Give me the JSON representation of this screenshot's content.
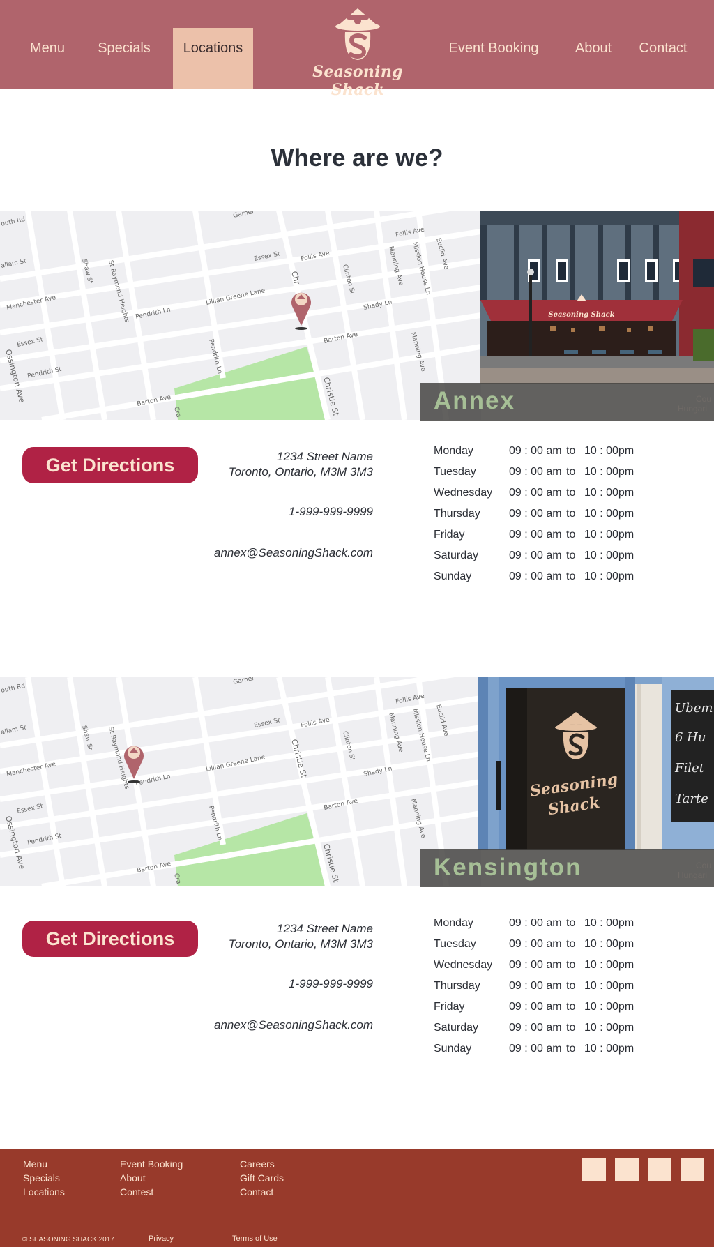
{
  "header": {
    "nav": [
      {
        "label": "Menu"
      },
      {
        "label": "Specials"
      },
      {
        "label": "Locations"
      },
      {
        "label": "Event Booking"
      },
      {
        "label": "About"
      },
      {
        "label": "Contact"
      }
    ],
    "logo_text": "Seasoning Shack"
  },
  "page_title": "Where are we?",
  "map_labels": {
    "streets": [
      "outh Rd",
      "allam St",
      "Manchester Ave",
      "Essex St",
      "Pendrith St",
      "Ossington Ave",
      "Shaw St",
      "St Raymond Heights",
      "Pendrith Ln",
      "Lillian Greene Lane",
      "Essex St",
      "Follis Ave",
      "Follis Ave",
      "Clinton St",
      "Manning Ave",
      "Mission House Ln",
      "Euclid Ave",
      "Shady Ln",
      "Barton Ave",
      "Barton Ave",
      "Pendrith Ln",
      "Christie St",
      "Manning Ave",
      "Garner",
      "Cra"
    ],
    "annex_pin_street": "Chr",
    "overlay_right": [
      "Cou",
      "Hungari"
    ]
  },
  "annex_sign_text": "Seasoning Shack",
  "kensington_sign_text": [
    "Seasoning",
    "Shack"
  ],
  "chalkboard_text": [
    "Ubem",
    "6 Hu",
    "Filet",
    "Tarte"
  ],
  "locations": [
    {
      "name": "Annex",
      "directions_label": "Get Directions",
      "address_line1": "1234 Street Name",
      "address_line2": "Toronto, Ontario, M3M 3M3",
      "phone": "1-999-999-9999",
      "email": "annex@SeasoningShack.com",
      "hours": [
        {
          "day": "Monday",
          "open": "09 : 00 am",
          "to": "to",
          "close": "10 : 00pm"
        },
        {
          "day": "Tuesday",
          "open": "09 : 00 am",
          "to": "to",
          "close": "10 : 00pm"
        },
        {
          "day": "Wednesday",
          "open": "09 : 00 am",
          "to": "to",
          "close": "10 : 00pm"
        },
        {
          "day": "Thursday",
          "open": "09 : 00 am",
          "to": "to",
          "close": "10 : 00pm"
        },
        {
          "day": "Friday",
          "open": "09 : 00 am",
          "to": "to",
          "close": "10 : 00pm"
        },
        {
          "day": "Saturday",
          "open": "09 : 00 am",
          "to": "to",
          "close": "10 : 00pm"
        },
        {
          "day": "Sunday",
          "open": "09 : 00 am",
          "to": "to",
          "close": "10 : 00pm"
        }
      ]
    },
    {
      "name": "Kensington",
      "directions_label": "Get Directions",
      "address_line1": "1234 Street Name",
      "address_line2": "Toronto, Ontario, M3M 3M3",
      "phone": "1-999-999-9999",
      "email": "annex@SeasoningShack.com",
      "hours": [
        {
          "day": "Monday",
          "open": "09 : 00 am",
          "to": "to",
          "close": "10 : 00pm"
        },
        {
          "day": "Tuesday",
          "open": "09 : 00 am",
          "to": "to",
          "close": "10 : 00pm"
        },
        {
          "day": "Wednesday",
          "open": "09 : 00 am",
          "to": "to",
          "close": "10 : 00pm"
        },
        {
          "day": "Thursday",
          "open": "09 : 00 am",
          "to": "to",
          "close": "10 : 00pm"
        },
        {
          "day": "Friday",
          "open": "09 : 00 am",
          "to": "to",
          "close": "10 : 00pm"
        },
        {
          "day": "Saturday",
          "open": "09 : 00 am",
          "to": "to",
          "close": "10 : 00pm"
        },
        {
          "day": "Sunday",
          "open": "09 : 00 am",
          "to": "to",
          "close": "10 : 00pm"
        }
      ]
    }
  ],
  "footer": {
    "col1": [
      "Menu",
      "Specials",
      "Locations"
    ],
    "col2": [
      "Event Booking",
      "About",
      "Contest"
    ],
    "col3": [
      "Careers",
      "Gift Cards",
      "Contact"
    ],
    "copyright": "© SEASONING SHACK 2017",
    "privacy": "Privacy",
    "terms": "Terms of Use"
  },
  "colors": {
    "header_bg": "#b0646c",
    "nav_active_bg": "#ecc1aa",
    "button_bg": "#b02245",
    "footer_bg": "#983a2b",
    "cream": "#fbe3cf",
    "location_name": "#a6bf96"
  }
}
